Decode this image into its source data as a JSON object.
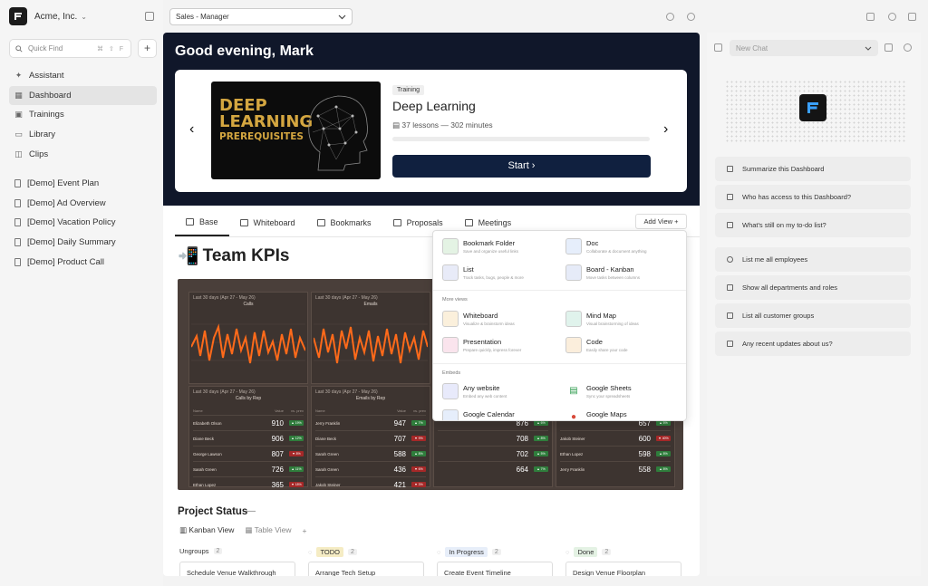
{
  "sidebar": {
    "org_name": "Acme, Inc.",
    "quickfind_placeholder": "Quick Find",
    "quickfind_shortcut": "⌘ ⇧ F",
    "plus": "+",
    "nav": [
      {
        "label": "Assistant",
        "icon": "assistant-icon"
      },
      {
        "label": "Dashboard",
        "icon": "dashboard-icon",
        "active": true
      },
      {
        "label": "Trainings",
        "icon": "trainings-icon"
      },
      {
        "label": "Library",
        "icon": "library-icon"
      },
      {
        "label": "Clips",
        "icon": "clips-icon"
      }
    ],
    "docs": [
      {
        "label": "[Demo] Event Plan"
      },
      {
        "label": "[Demo] Ad Overview"
      },
      {
        "label": "[Demo] Vacation Policy"
      },
      {
        "label": "[Demo] Daily Summary"
      },
      {
        "label": "[Demo] Product Call"
      }
    ]
  },
  "topbar": {
    "selector_value": "Sales - Manager"
  },
  "hero": {
    "greeting": "Good evening, Mark",
    "thumb_l1": "DEEP",
    "thumb_l2": "LEARNING",
    "thumb_l3": "PREREQUISITES",
    "tag": "Training",
    "title": "Deep Learning",
    "meta": "37 lessons — 302 minutes",
    "progress": 0.0,
    "start_label": "Start ›"
  },
  "tabs": [
    {
      "label": "Base",
      "active": true
    },
    {
      "label": "Whiteboard"
    },
    {
      "label": "Bookmarks"
    },
    {
      "label": "Proposals"
    },
    {
      "label": "Meetings"
    }
  ],
  "add_view_label": "Add View +",
  "kpi": {
    "title": "Team KPIs",
    "emoji": "📲",
    "charts": [
      {
        "range": "Last 30 days (Apr 27 - May 26)",
        "title": "Calls"
      },
      {
        "range": "Last 30 days (Apr 27 - May 26)",
        "title": "Emails"
      }
    ],
    "tables": [
      {
        "range": "Last 30 days (Apr 27 - May 26)",
        "title": "Calls by Rep",
        "h_name": "Name",
        "h_value": "Value",
        "h_change": "vs. prev",
        "rows": [
          {
            "name": "Elizabeth Olson",
            "value": "910",
            "change": "▲ 19%",
            "dir": "up"
          },
          {
            "name": "Diane Beck",
            "value": "906",
            "change": "▲ 12%",
            "dir": "up"
          },
          {
            "name": "George Lawson",
            "value": "807",
            "change": "▼ 8%",
            "dir": "dn"
          },
          {
            "name": "Sarah Green",
            "value": "726",
            "change": "▲ 11%",
            "dir": "up"
          },
          {
            "name": "Ethan Lopez",
            "value": "365",
            "change": "▼ 18%",
            "dir": "dn"
          }
        ]
      },
      {
        "range": "Last 30 days (Apr 27 - May 26)",
        "title": "Emails by Rep",
        "h_name": "Name",
        "h_value": "Value",
        "h_change": "vs. prev",
        "rows": [
          {
            "name": "Jerry Franklin",
            "value": "947",
            "change": "▲ 7%",
            "dir": "up"
          },
          {
            "name": "Diane Beck",
            "value": "707",
            "change": "▼ 9%",
            "dir": "dn"
          },
          {
            "name": "Sarah Green",
            "value": "588",
            "change": "▲ 8%",
            "dir": "up"
          },
          {
            "name": "Sarah Green",
            "value": "436",
            "change": "▼ 6%",
            "dir": "dn"
          },
          {
            "name": "Jakob Steiner",
            "value": "421",
            "change": "▼ 3%",
            "dir": "dn"
          }
        ]
      },
      {
        "rows": [
          {
            "name": "",
            "value": "876",
            "change": "▲ 6%",
            "dir": "up"
          },
          {
            "name": "",
            "value": "708",
            "change": "▲ 8%",
            "dir": "up"
          },
          {
            "name": "",
            "value": "702",
            "change": "▲ 5%",
            "dir": "up"
          },
          {
            "name": "",
            "value": "664",
            "change": "▲ 7%",
            "dir": "up"
          }
        ]
      },
      {
        "rows": [
          {
            "name": "",
            "value": "661",
            "change": "▲",
            "dir": "up"
          },
          {
            "name": "",
            "value": "657",
            "change": "▲ 5%",
            "dir": "up"
          },
          {
            "name": "Jakob Steiner",
            "value": "600",
            "change": "▼ 40%",
            "dir": "dn"
          },
          {
            "name": "Ethan Lopez",
            "value": "598",
            "change": "▲ 8%",
            "dir": "up"
          },
          {
            "name": "Jerry Franklin",
            "value": "558",
            "change": "▲ 8%",
            "dir": "up"
          }
        ]
      }
    ]
  },
  "project_status": {
    "title": "Project Status",
    "minus": "—",
    "views": [
      {
        "label": "Kanban View",
        "active": true
      },
      {
        "label": "Table View"
      }
    ],
    "plus": "+",
    "columns": [
      {
        "label": "Ungroups",
        "count": "2",
        "card": "Schedule Venue Walkthrough",
        "pill": ""
      },
      {
        "label": "TODO",
        "count": "2",
        "card": "Arrange Tech Setup",
        "pill": "#f5ecc4"
      },
      {
        "label": "In Progress",
        "count": "2",
        "card": "Create Event Timeline",
        "pill": "#e7eef9"
      },
      {
        "label": "Done",
        "count": "2",
        "card": "Design Venue Floorplan",
        "pill": "#e4f2e4"
      }
    ]
  },
  "dropdown": {
    "items_top": [
      {
        "name": "Bookmark Folder",
        "desc": "Save and organize useful links",
        "color": "#7cba7f"
      },
      {
        "name": "Doc",
        "desc": "Collaborate & document anything",
        "color": "#5a8fd8"
      },
      {
        "name": "List",
        "desc": "Track tasks, bugs, people & more",
        "color": "#5266b8"
      },
      {
        "name": "Board - Kanban",
        "desc": "Move tasks between columns",
        "color": "#4a68b8"
      }
    ],
    "more_views_label": "More views",
    "items_more": [
      {
        "name": "Whiteboard",
        "desc": "Visualize & brainstorm ideas",
        "color": "#e0a83a"
      },
      {
        "name": "Mind Map",
        "desc": "Visual brainstorming of ideas",
        "color": "#4aa88a"
      },
      {
        "name": "Presentation",
        "desc": "Prepare quickly, impress forever",
        "color": "#d85a8a"
      },
      {
        "name": "Code",
        "desc": "Easily share your code",
        "color": "#e09a3a"
      }
    ],
    "embeds_label": "Embeds",
    "items_embeds": [
      {
        "name": "Any website",
        "desc": "Embed any web content",
        "color": "#6a7ad8"
      },
      {
        "name": "Google Sheets",
        "desc": "Sync your spreadsheets",
        "color": "#2a9a4a"
      },
      {
        "name": "Google Calendar",
        "desc": "",
        "color": "#3a7ad8"
      },
      {
        "name": "Google Maps",
        "desc": "",
        "color": "#d84a3a"
      }
    ]
  },
  "right_panel": {
    "chat_placeholder": "New Chat",
    "suggestions_a": [
      "Summarize this Dashboard",
      "Who has access to this Dashboard?",
      "What's still on my to-do list?"
    ],
    "suggestions_b": [
      "List me all employees",
      "Show all departments and roles",
      "List all customer groups",
      "Any recent updates about us?"
    ]
  },
  "colors": {
    "accent": "#10203f",
    "hero_bg": "#10172a",
    "chart_line": "#ff6a1a",
    "kpi_bg": "#4a3f3a"
  }
}
